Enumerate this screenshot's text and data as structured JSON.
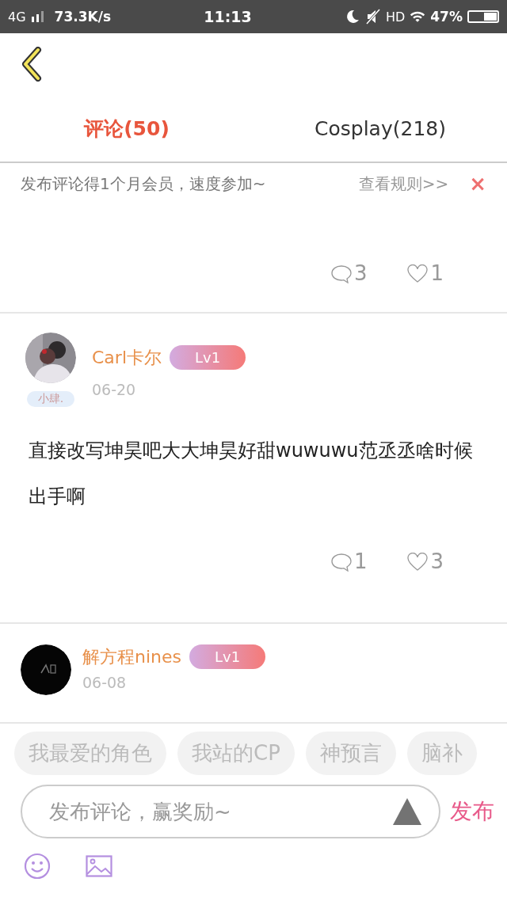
{
  "status_bar": {
    "network": "4G",
    "speed": "73.3K/s",
    "time": "11:13",
    "hd": "HD",
    "battery": "47%"
  },
  "tabs": [
    {
      "label": "评论(50)",
      "selected": true
    },
    {
      "label": "Cosplay(218)",
      "selected": false
    }
  ],
  "banner": {
    "text": "发布评论得1个月会员，速度参加~",
    "link": "查看规则>>",
    "close": "×"
  },
  "comments": [
    {
      "kind": "tail",
      "replies": "3",
      "likes": "1"
    },
    {
      "kind": "full",
      "name": "Carl卡尔",
      "level": "Lv1",
      "tag": "小肆.",
      "date": "06-20",
      "text": "直接改写坤昊吧大大坤昊好甜wuwuwu范丞丞啥时候出手啊",
      "replies": "1",
      "likes": "3"
    },
    {
      "kind": "head",
      "name": "解方程nines",
      "level": "Lv1",
      "date": "06-08"
    }
  ],
  "quick_tags": [
    "我最爱的角色",
    "我站的CP",
    "神预言",
    "脑补"
  ],
  "input": {
    "placeholder": "发布评论，赢奖励~",
    "send": "发布"
  }
}
